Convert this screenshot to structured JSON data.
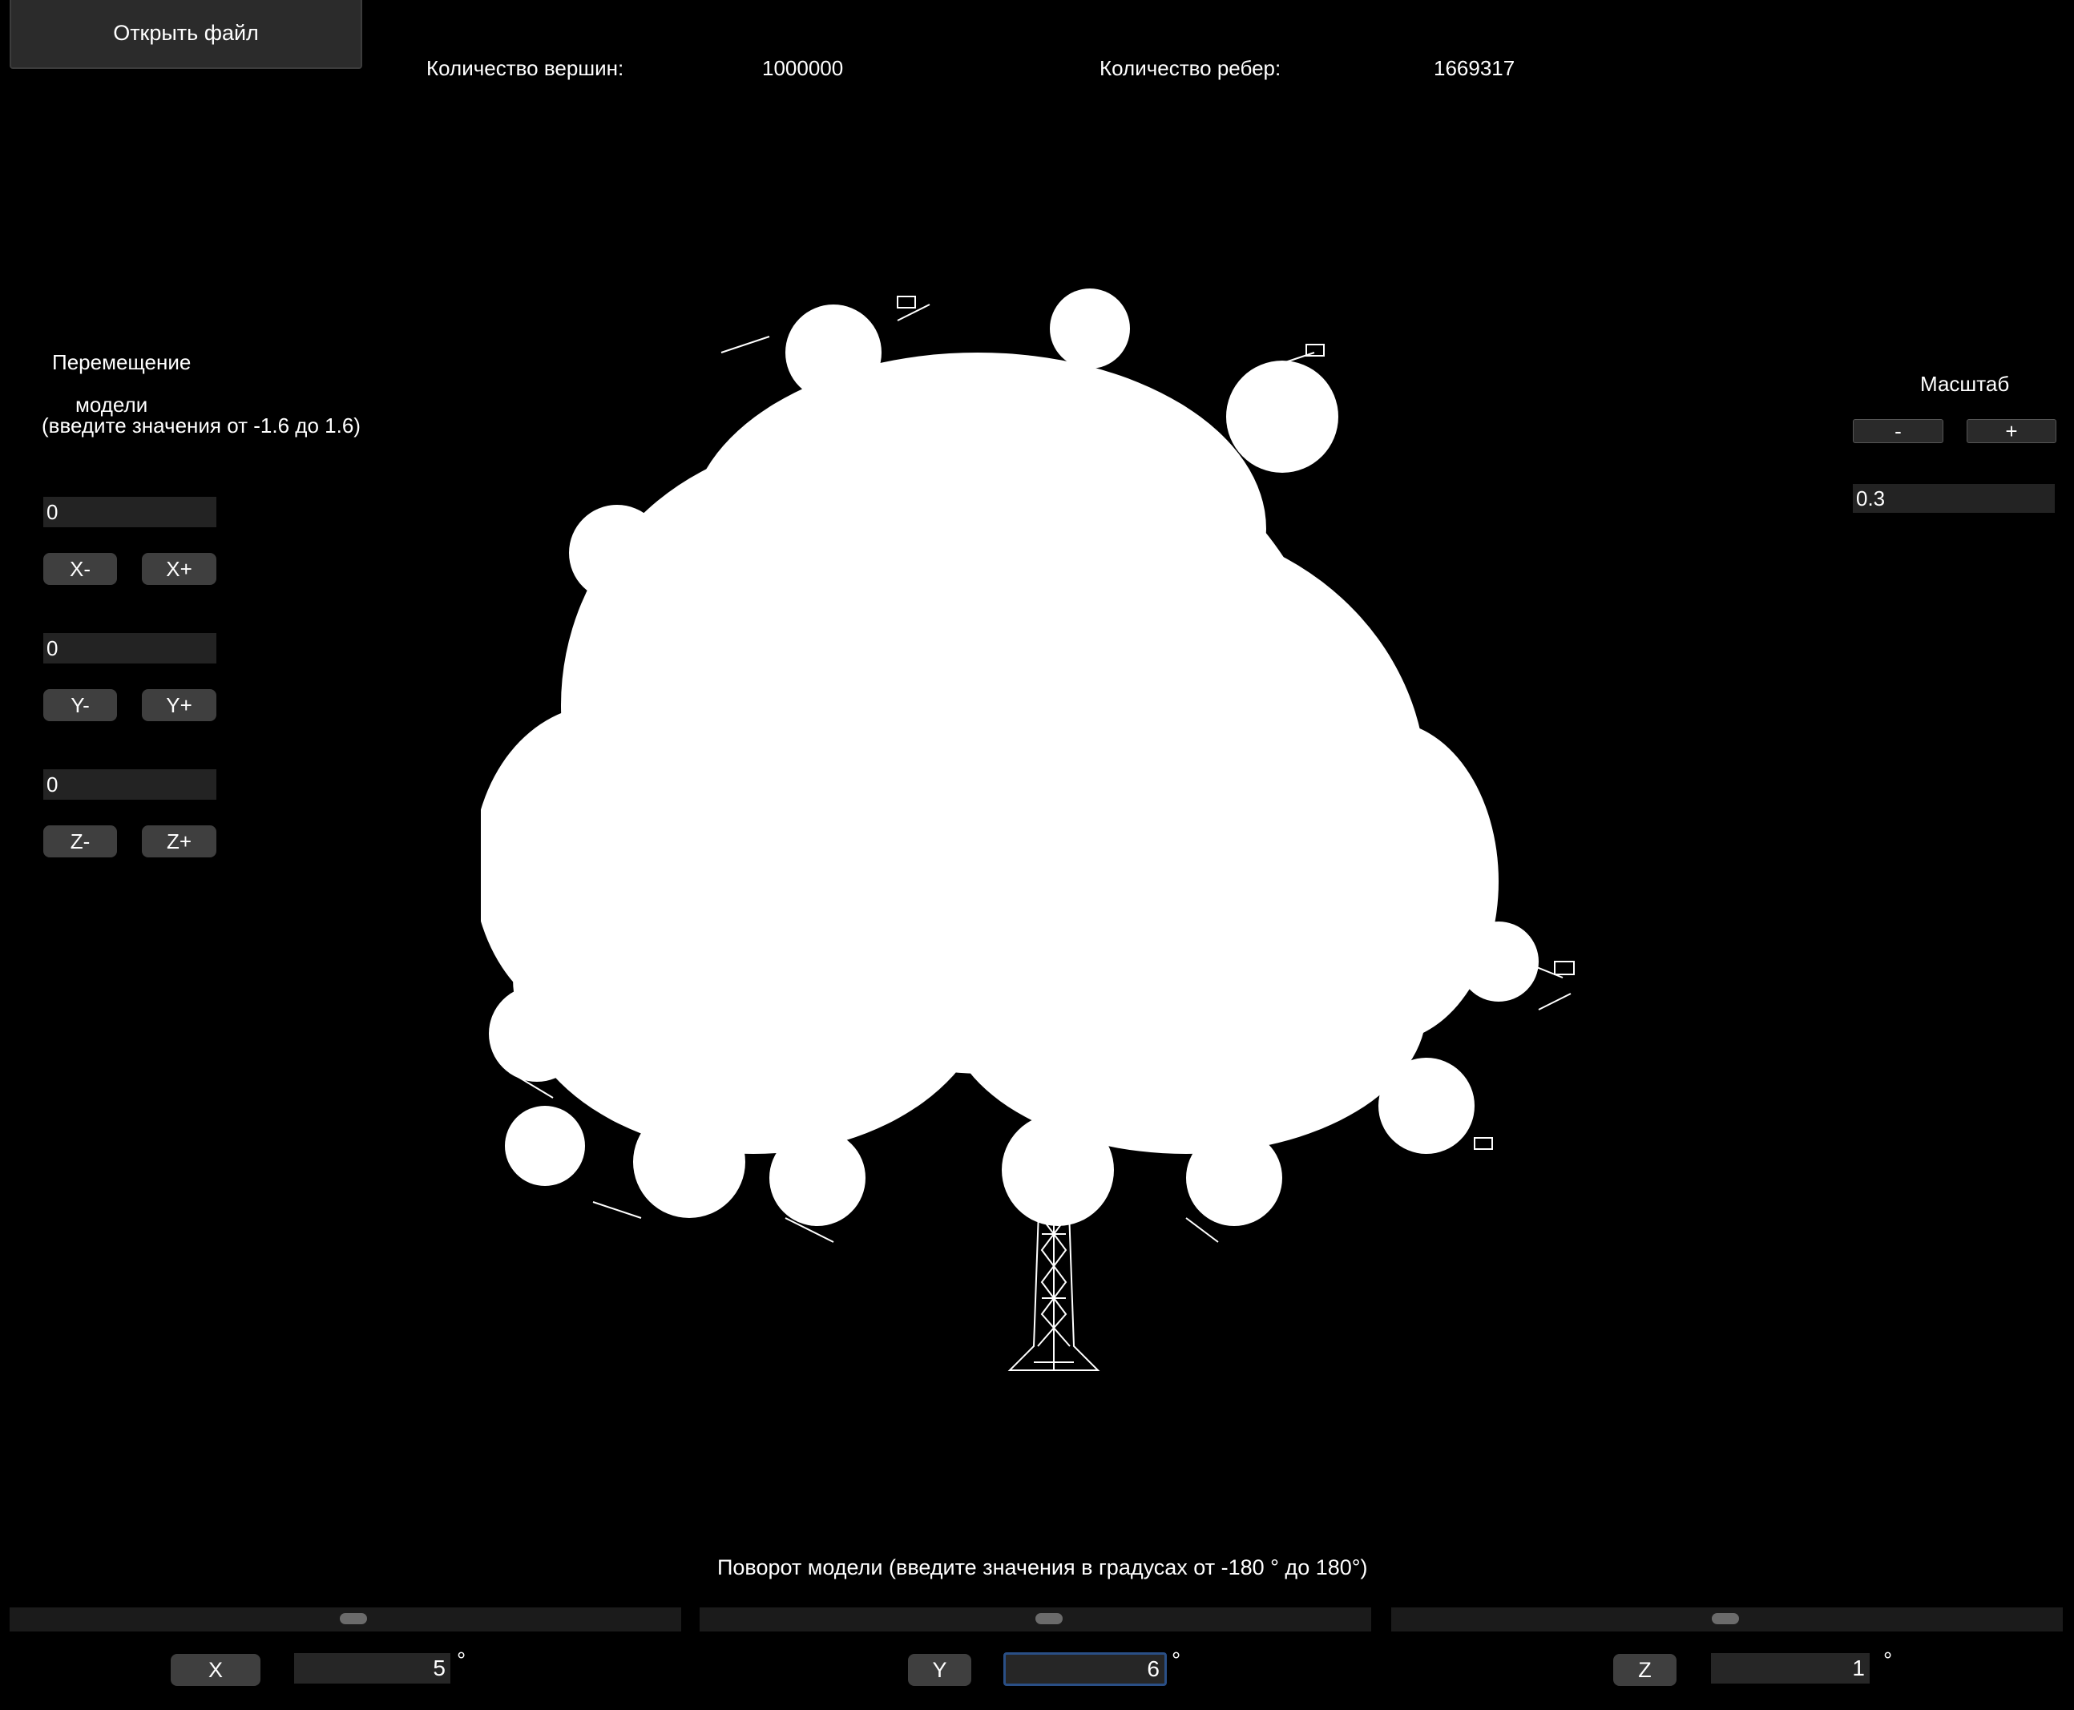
{
  "toolbar": {
    "open_file_label": "Открыть файл"
  },
  "stats": {
    "vertices_label": "Количество вершин:",
    "vertices_value": "1000000",
    "edges_label": "Количество ребер:",
    "edges_value": "1669317"
  },
  "translation": {
    "title_line1": "Перемещение",
    "title_line2": "модели",
    "hint": "(введите значения от -1.6 до 1.6)",
    "x": {
      "value": "0",
      "minus_label": "X-",
      "plus_label": "X+"
    },
    "y": {
      "value": "0",
      "minus_label": "Y-",
      "plus_label": "Y+"
    },
    "z": {
      "value": "0",
      "minus_label": "Z-",
      "plus_label": "Z+"
    }
  },
  "scale": {
    "title": "Масштаб",
    "minus_label": "-",
    "plus_label": "+",
    "value": "0.3"
  },
  "rotation": {
    "title": "Поворот модели (введите значения в градусах от -180 ° до 180°)",
    "degree_symbol": "°",
    "x": {
      "label": "X",
      "value": "5"
    },
    "y": {
      "label": "Y",
      "value": "6"
    },
    "z": {
      "label": "Z",
      "value": "1"
    }
  },
  "viewport": {
    "model": "tree-wireframe",
    "background": "#000000",
    "line_color": "#ffffff"
  }
}
